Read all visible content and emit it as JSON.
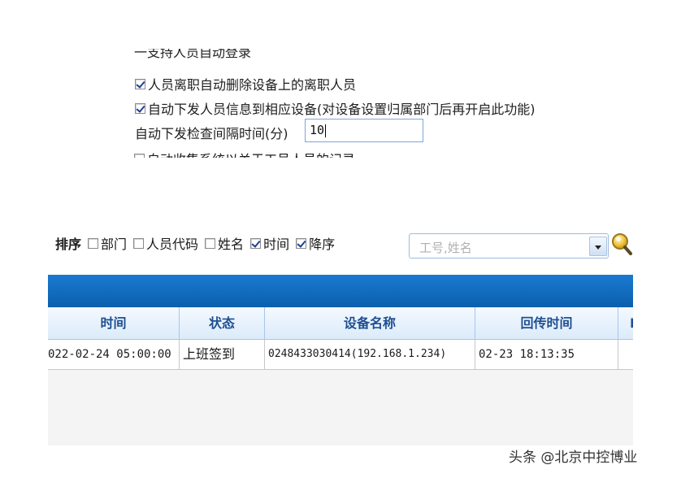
{
  "settings": {
    "top_cut_text": "一支持人员自动登录",
    "options": [
      {
        "label": "人员离职自动删除设备上的离职人员",
        "checked": true
      },
      {
        "label": "自动下发人员信息到相应设备(对设备设置归属部门后再开启此功能)",
        "checked": true
      }
    ],
    "interval_label": "自动下发检查间隔时间(分)",
    "interval_value": "10",
    "bottom_cut_text": "自动收集系统以关于工号人员的记录",
    "bottom_cut_checked": false
  },
  "sort": {
    "label": "排序",
    "options": [
      {
        "label": "部门",
        "checked": false
      },
      {
        "label": "人员代码",
        "checked": false
      },
      {
        "label": "姓名",
        "checked": false
      },
      {
        "label": "时间",
        "checked": true
      },
      {
        "label": "降序",
        "checked": true
      }
    ]
  },
  "search": {
    "placeholder": "工号,姓名",
    "icon": "magnifier-icon"
  },
  "table": {
    "columns": [
      "时间",
      "状态",
      "设备名称",
      "回传时间",
      "I"
    ],
    "rows": [
      [
        "022-02-24 05:00:00",
        "上班签到",
        "0248433030414(192.168.1.234)",
        "02-23 18:13:35",
        ""
      ]
    ]
  },
  "watermark": "头条 @北京中控博业",
  "colors": {
    "header_bar": "#0b6cc1",
    "grid_header_text": "#1e4f91",
    "check": "#1b3f93"
  }
}
